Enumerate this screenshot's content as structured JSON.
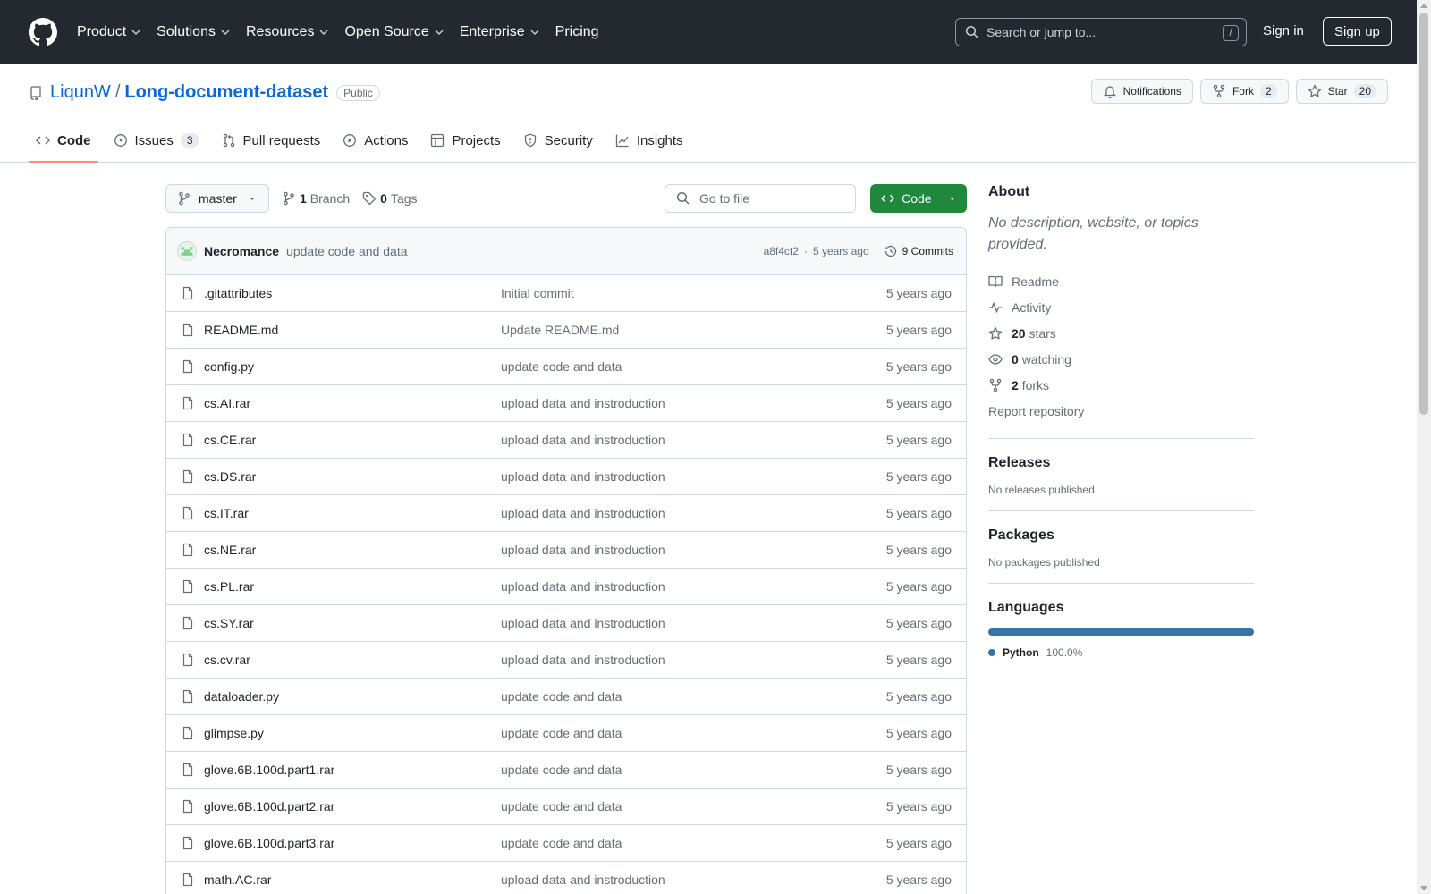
{
  "header": {
    "nav": [
      "Product",
      "Solutions",
      "Resources",
      "Open Source",
      "Enterprise",
      "Pricing"
    ],
    "search_placeholder": "Search or jump to...",
    "search_shortcut": "/",
    "sign_in": "Sign in",
    "sign_up": "Sign up"
  },
  "repo": {
    "owner": "LiqunW",
    "separator": "/",
    "name": "Long-document-dataset",
    "visibility": "Public",
    "notifications_label": "Notifications",
    "fork_label": "Fork",
    "fork_count": "2",
    "star_label": "Star",
    "star_count": "20"
  },
  "tabs": [
    {
      "label": "Code",
      "count": ""
    },
    {
      "label": "Issues",
      "count": "3"
    },
    {
      "label": "Pull requests",
      "count": ""
    },
    {
      "label": "Actions",
      "count": ""
    },
    {
      "label": "Projects",
      "count": ""
    },
    {
      "label": "Security",
      "count": ""
    },
    {
      "label": "Insights",
      "count": ""
    }
  ],
  "toolbar": {
    "branch": "master",
    "branch_count": "1",
    "branch_label": "Branch",
    "tag_count": "0",
    "tag_label": "Tags",
    "goto_placeholder": "Go to file",
    "code_label": "Code"
  },
  "commit": {
    "author": "Necromance",
    "message": "update code and data",
    "hash": "a8f4cf2",
    "dot": "·",
    "age": "5 years ago",
    "commits_label": "9 Commits"
  },
  "files": [
    {
      "name": ".gitattributes",
      "message": "Initial commit",
      "age": "5 years ago"
    },
    {
      "name": "README.md",
      "message": "Update README.md",
      "age": "5 years ago"
    },
    {
      "name": "config.py",
      "message": "update code and data",
      "age": "5 years ago"
    },
    {
      "name": "cs.AI.rar",
      "message": "upload data and instroduction",
      "age": "5 years ago"
    },
    {
      "name": "cs.CE.rar",
      "message": "upload data and instroduction",
      "age": "5 years ago"
    },
    {
      "name": "cs.DS.rar",
      "message": "upload data and instroduction",
      "age": "5 years ago"
    },
    {
      "name": "cs.IT.rar",
      "message": "upload data and instroduction",
      "age": "5 years ago"
    },
    {
      "name": "cs.NE.rar",
      "message": "upload data and instroduction",
      "age": "5 years ago"
    },
    {
      "name": "cs.PL.rar",
      "message": "upload data and instroduction",
      "age": "5 years ago"
    },
    {
      "name": "cs.SY.rar",
      "message": "upload data and instroduction",
      "age": "5 years ago"
    },
    {
      "name": "cs.cv.rar",
      "message": "upload data and instroduction",
      "age": "5 years ago"
    },
    {
      "name": "dataloader.py",
      "message": "update code and data",
      "age": "5 years ago"
    },
    {
      "name": "glimpse.py",
      "message": "update code and data",
      "age": "5 years ago"
    },
    {
      "name": "glove.6B.100d.part1.rar",
      "message": "update code and data",
      "age": "5 years ago"
    },
    {
      "name": "glove.6B.100d.part2.rar",
      "message": "update code and data",
      "age": "5 years ago"
    },
    {
      "name": "glove.6B.100d.part3.rar",
      "message": "update code and data",
      "age": "5 years ago"
    },
    {
      "name": "math.AC.rar",
      "message": "upload data and instroduction",
      "age": "5 years ago"
    }
  ],
  "about": {
    "title": "About",
    "description": "No description, website, or topics provided.",
    "readme": "Readme",
    "activity": "Activity",
    "stars_count": "20",
    "stars_label": "stars",
    "watching_count": "0",
    "watching_label": "watching",
    "forks_count": "2",
    "forks_label": "forks",
    "report": "Report repository"
  },
  "releases": {
    "title": "Releases",
    "text": "No releases published"
  },
  "packages": {
    "title": "Packages",
    "text": "No packages published"
  },
  "languages": {
    "title": "Languages",
    "items": [
      {
        "name": "Python",
        "percent": "100.0%",
        "color": "#3572A5"
      }
    ]
  },
  "colors": {
    "header_bg": "#24292f",
    "link": "#0969da",
    "code_button": "#1f883d",
    "active_tab_underline": "#fd8c73"
  }
}
